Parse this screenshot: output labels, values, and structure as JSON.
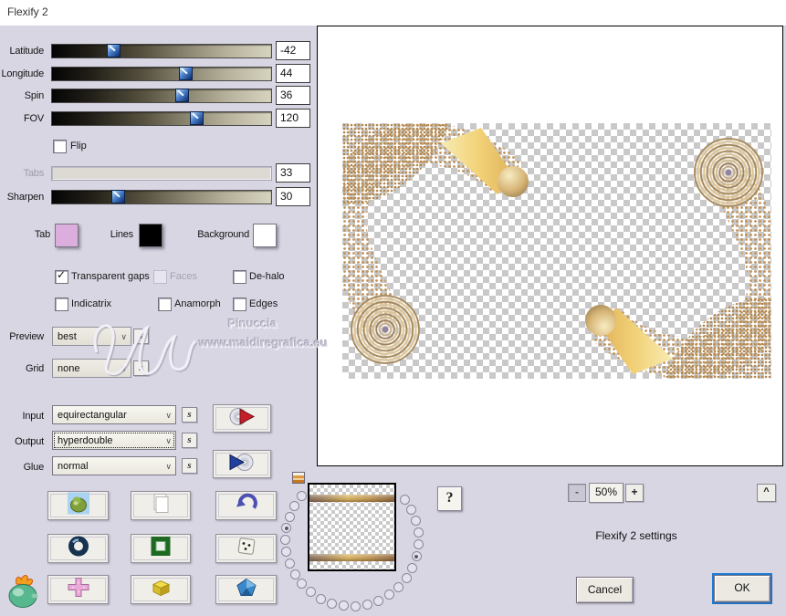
{
  "window": {
    "title": "Flexify 2"
  },
  "sliders": [
    {
      "label": "Latitude",
      "value": "-42"
    },
    {
      "label": "Longitude",
      "value": "44"
    },
    {
      "label": "Spin",
      "value": "36"
    },
    {
      "label": "FOV",
      "value": "120"
    },
    {
      "label": "Tabs",
      "value": "33"
    },
    {
      "label": "Sharpen",
      "value": "30"
    }
  ],
  "flip_label": "Flip",
  "swatches": [
    {
      "label": "Tab",
      "color": "#dcaede"
    },
    {
      "label": "Lines",
      "color": "#000000"
    },
    {
      "label": "Background",
      "color": "#ffffff"
    }
  ],
  "options": [
    {
      "label": "Transparent gaps",
      "checked": true,
      "disabled": false
    },
    {
      "label": "Faces",
      "checked": false,
      "disabled": true
    },
    {
      "label": "De-halo",
      "checked": false,
      "disabled": false
    },
    {
      "label": "Indicatrix",
      "checked": false,
      "disabled": false
    },
    {
      "label": "Anamorph",
      "checked": false,
      "disabled": false
    },
    {
      "label": "Edges",
      "checked": false,
      "disabled": false
    }
  ],
  "selects": {
    "preview_label": "Preview",
    "preview_value": "best",
    "grid_label": "Grid",
    "grid_value": "none",
    "input_label": "Input",
    "input_value": "equirectangular",
    "output_label": "Output",
    "output_value": "hyperdouble",
    "glue_label": "Glue",
    "glue_value": "normal",
    "s_button": "s"
  },
  "icons": {
    "io_buttons": [
      "disc-red-arrow",
      "disc-blue-arrow"
    ],
    "grid_row1": [
      "pear",
      "copy",
      "undo"
    ],
    "grid_row2": [
      "ring",
      "frame",
      "dice"
    ],
    "grid_row3": [
      "cross",
      "box",
      "pentagon"
    ],
    "logo": "flaming-pear"
  },
  "watermark": {
    "name": "Pinuccia",
    "site": "www.maidiregrafica.eu"
  },
  "zoombar": {
    "minus": "-",
    "level": "50%",
    "plus": "+",
    "collapse": "^"
  },
  "help_label": "?",
  "footer": {
    "status": "Flexify 2 settings",
    "cancel": "Cancel",
    "ok": "OK"
  },
  "colors": {
    "dialog_bg": "#d9d6e3",
    "focus_blue": "#1d7bd7",
    "gold_dots": "#bf9156",
    "checker_gray": "#c9c9c9"
  }
}
